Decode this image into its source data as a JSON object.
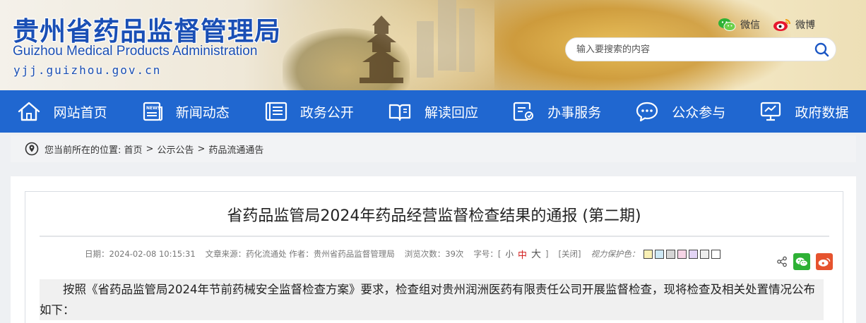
{
  "header": {
    "title_cn": "贵州省药品监督管理局",
    "title_en": "Guizhou Medical Products Administration",
    "url": "yjj.guizhou.gov.cn",
    "social": [
      {
        "label": "微信",
        "icon": "wechat-icon"
      },
      {
        "label": "微博",
        "icon": "weibo-icon"
      }
    ],
    "search_placeholder": "输入要搜索的内容"
  },
  "nav": [
    {
      "label": "网站首页",
      "icon": "home-icon"
    },
    {
      "label": "新闻动态",
      "icon": "news-icon"
    },
    {
      "label": "政务公开",
      "icon": "document-list-icon"
    },
    {
      "label": "解读回应",
      "icon": "open-book-icon"
    },
    {
      "label": "办事服务",
      "icon": "service-form-icon"
    },
    {
      "label": "公众参与",
      "icon": "chat-bubble-icon"
    },
    {
      "label": "政府数据",
      "icon": "data-monitor-icon"
    }
  ],
  "breadcrumb": {
    "prefix": "您当前所在的位置:",
    "items": [
      "首页",
      "公示公告",
      "药品流通通告"
    ],
    "separator": ">"
  },
  "article": {
    "title": "省药品监管局2024年药品经营监督检查结果的通报 (第二期)",
    "date": "日期：2024-02-08 10:15:31",
    "source": "文章来源：药化流通处 作者：贵州省药品监督管理局",
    "views": "浏览次数：39次",
    "font_size_label": "字号：[",
    "font_small": "小",
    "font_medium": "中",
    "font_large": "大",
    "font_close_bracket": "]",
    "close_label": "[关闭]",
    "vision_label": "视力保护色：",
    "swatches": [
      "#f9f0b5",
      "#cde8f5",
      "#d5d5d5",
      "#f6d4e6",
      "#e3d4f5",
      "#eeeeee",
      "#ffffff"
    ],
    "paragraph": "按照《省药品监管局2024年节前药械安全监督检查方案》要求，检查组对贵州润洲医药有限责任公司开展监督检查，现将检查及相关处置情况公布如下："
  },
  "colors": {
    "brand_blue": "#2067d0",
    "logo_blue": "#1a4fb5",
    "active_red": "#d31f1f",
    "wechat_green": "#2eb135",
    "weibo_red": "#e6532e"
  }
}
